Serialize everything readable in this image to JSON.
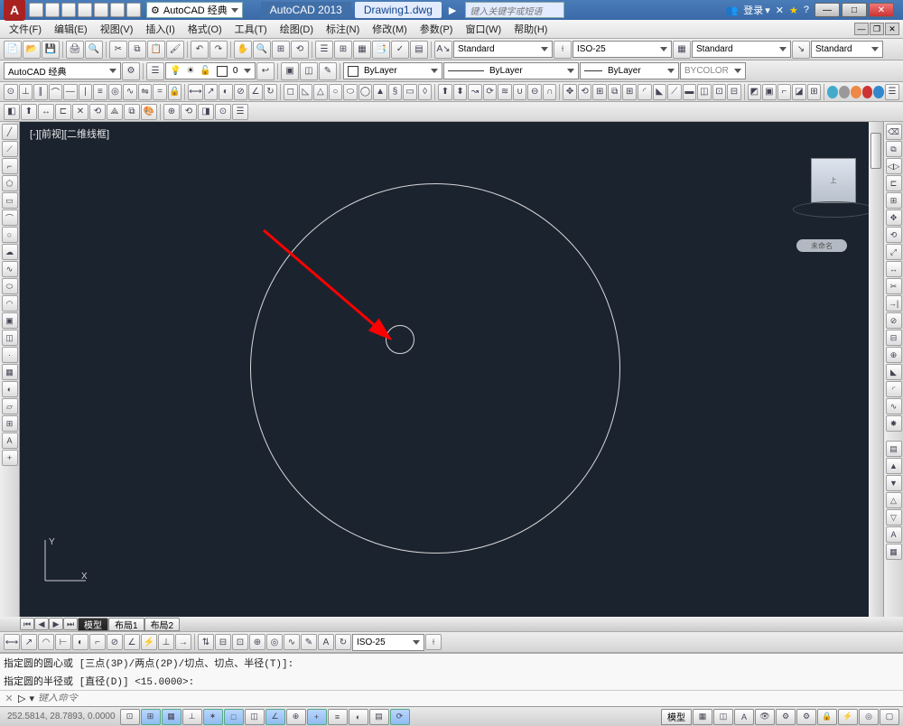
{
  "title": {
    "app_letter": "A",
    "workspace": "AutoCAD 经典",
    "app_name": "AutoCAD 2013",
    "file_name": "Drawing1.dwg",
    "search_placeholder": "键入关键字或短语",
    "login": "登录"
  },
  "menu": {
    "items": [
      "文件(F)",
      "编辑(E)",
      "视图(V)",
      "插入(I)",
      "格式(O)",
      "工具(T)",
      "绘图(D)",
      "标注(N)",
      "修改(M)",
      "参数(P)",
      "窗口(W)",
      "帮助(H)"
    ]
  },
  "std_toolbar": {
    "style1": "Standard",
    "style2": "ISO-25",
    "style3": "Standard",
    "style4": "Standard"
  },
  "layers_toolbar": {
    "workspace": "AutoCAD 经典",
    "layer": "0",
    "bylayer_color": "ByLayer",
    "bylayer_line": "ByLayer",
    "bylayer_weight": "ByLayer",
    "bycolor": "BYCOLOR"
  },
  "viewport": {
    "label": "[-][前视][二维线框]",
    "nav_badge": "未命名"
  },
  "tabs": {
    "model": "模型",
    "layout1": "布局1",
    "layout2": "布局2"
  },
  "dim_toolbar": {
    "style": "ISO-25"
  },
  "command": {
    "hist1": "指定圆的圆心或 [三点(3P)/两点(2P)/切点、切点、半径(T)]:",
    "hist2": "指定圆的半径或 [直径(D)] <15.0000>:",
    "prompt_icon": "▷",
    "placeholder": "键入命令"
  },
  "status": {
    "coords": "252.5814, 28.7893, 0.0000",
    "model_label": "模型"
  }
}
